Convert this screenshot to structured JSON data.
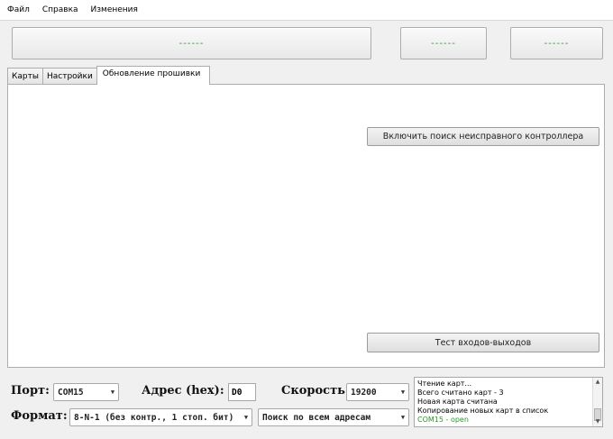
{
  "menu": [
    "Файл",
    "Справка",
    "Изменения"
  ],
  "status": {
    "main": "------",
    "secondary": "------",
    "tertiary": "------"
  },
  "tabs": [
    {
      "label": "Карты",
      "active": false
    },
    {
      "label": "Настройки",
      "active": false
    },
    {
      "label": "Обновление прошивки",
      "active": true
    }
  ],
  "panel": {
    "search_faulty_button": "Включить поиск неисправного контроллера",
    "io_test_button": "Тест входов-выходов"
  },
  "settings": {
    "port_label": "Порт:",
    "port_value": "COM15",
    "address_label": "Адрес (hex):",
    "address_value": "D0",
    "speed_label": "Скорость:",
    "speed_value": "19200",
    "format_label": "Формат:",
    "format_value": "8-N-1 (без контр., 1 стоп. бит)",
    "search_mode_value": "Поиск по всем адресам"
  },
  "log": [
    {
      "text": "Чтение карт...",
      "color": "#000000"
    },
    {
      "text": "Всего считано карт - 3",
      "color": "#000000"
    },
    {
      "text": "Новая карта считана",
      "color": "#000000"
    },
    {
      "text": "Копирование новых карт в список",
      "color": "#000000"
    },
    {
      "text": "COM15 - open",
      "color": "#2a9a2a"
    }
  ]
}
